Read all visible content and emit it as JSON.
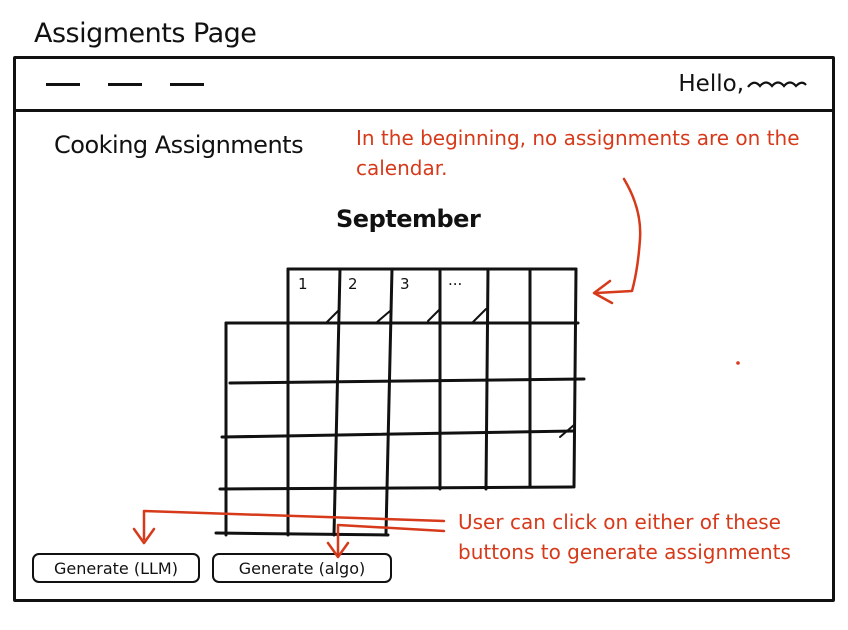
{
  "page_title": "Assigments Page",
  "header": {
    "greeting": "Hello,"
  },
  "main": {
    "section_title": "Cooking Assignments",
    "month": "September",
    "day_labels": [
      "1",
      "2",
      "3",
      "..."
    ]
  },
  "buttons": {
    "generate_llm": "Generate (LLM)",
    "generate_algo": "Generate (algo)"
  },
  "annotations": {
    "top_note": "In the beginning, no assignments are on the calendar.",
    "bottom_note": "User can click on either of these buttons to generate assignments"
  },
  "colors": {
    "ink": "#111111",
    "annotation": "#d63a1a"
  }
}
